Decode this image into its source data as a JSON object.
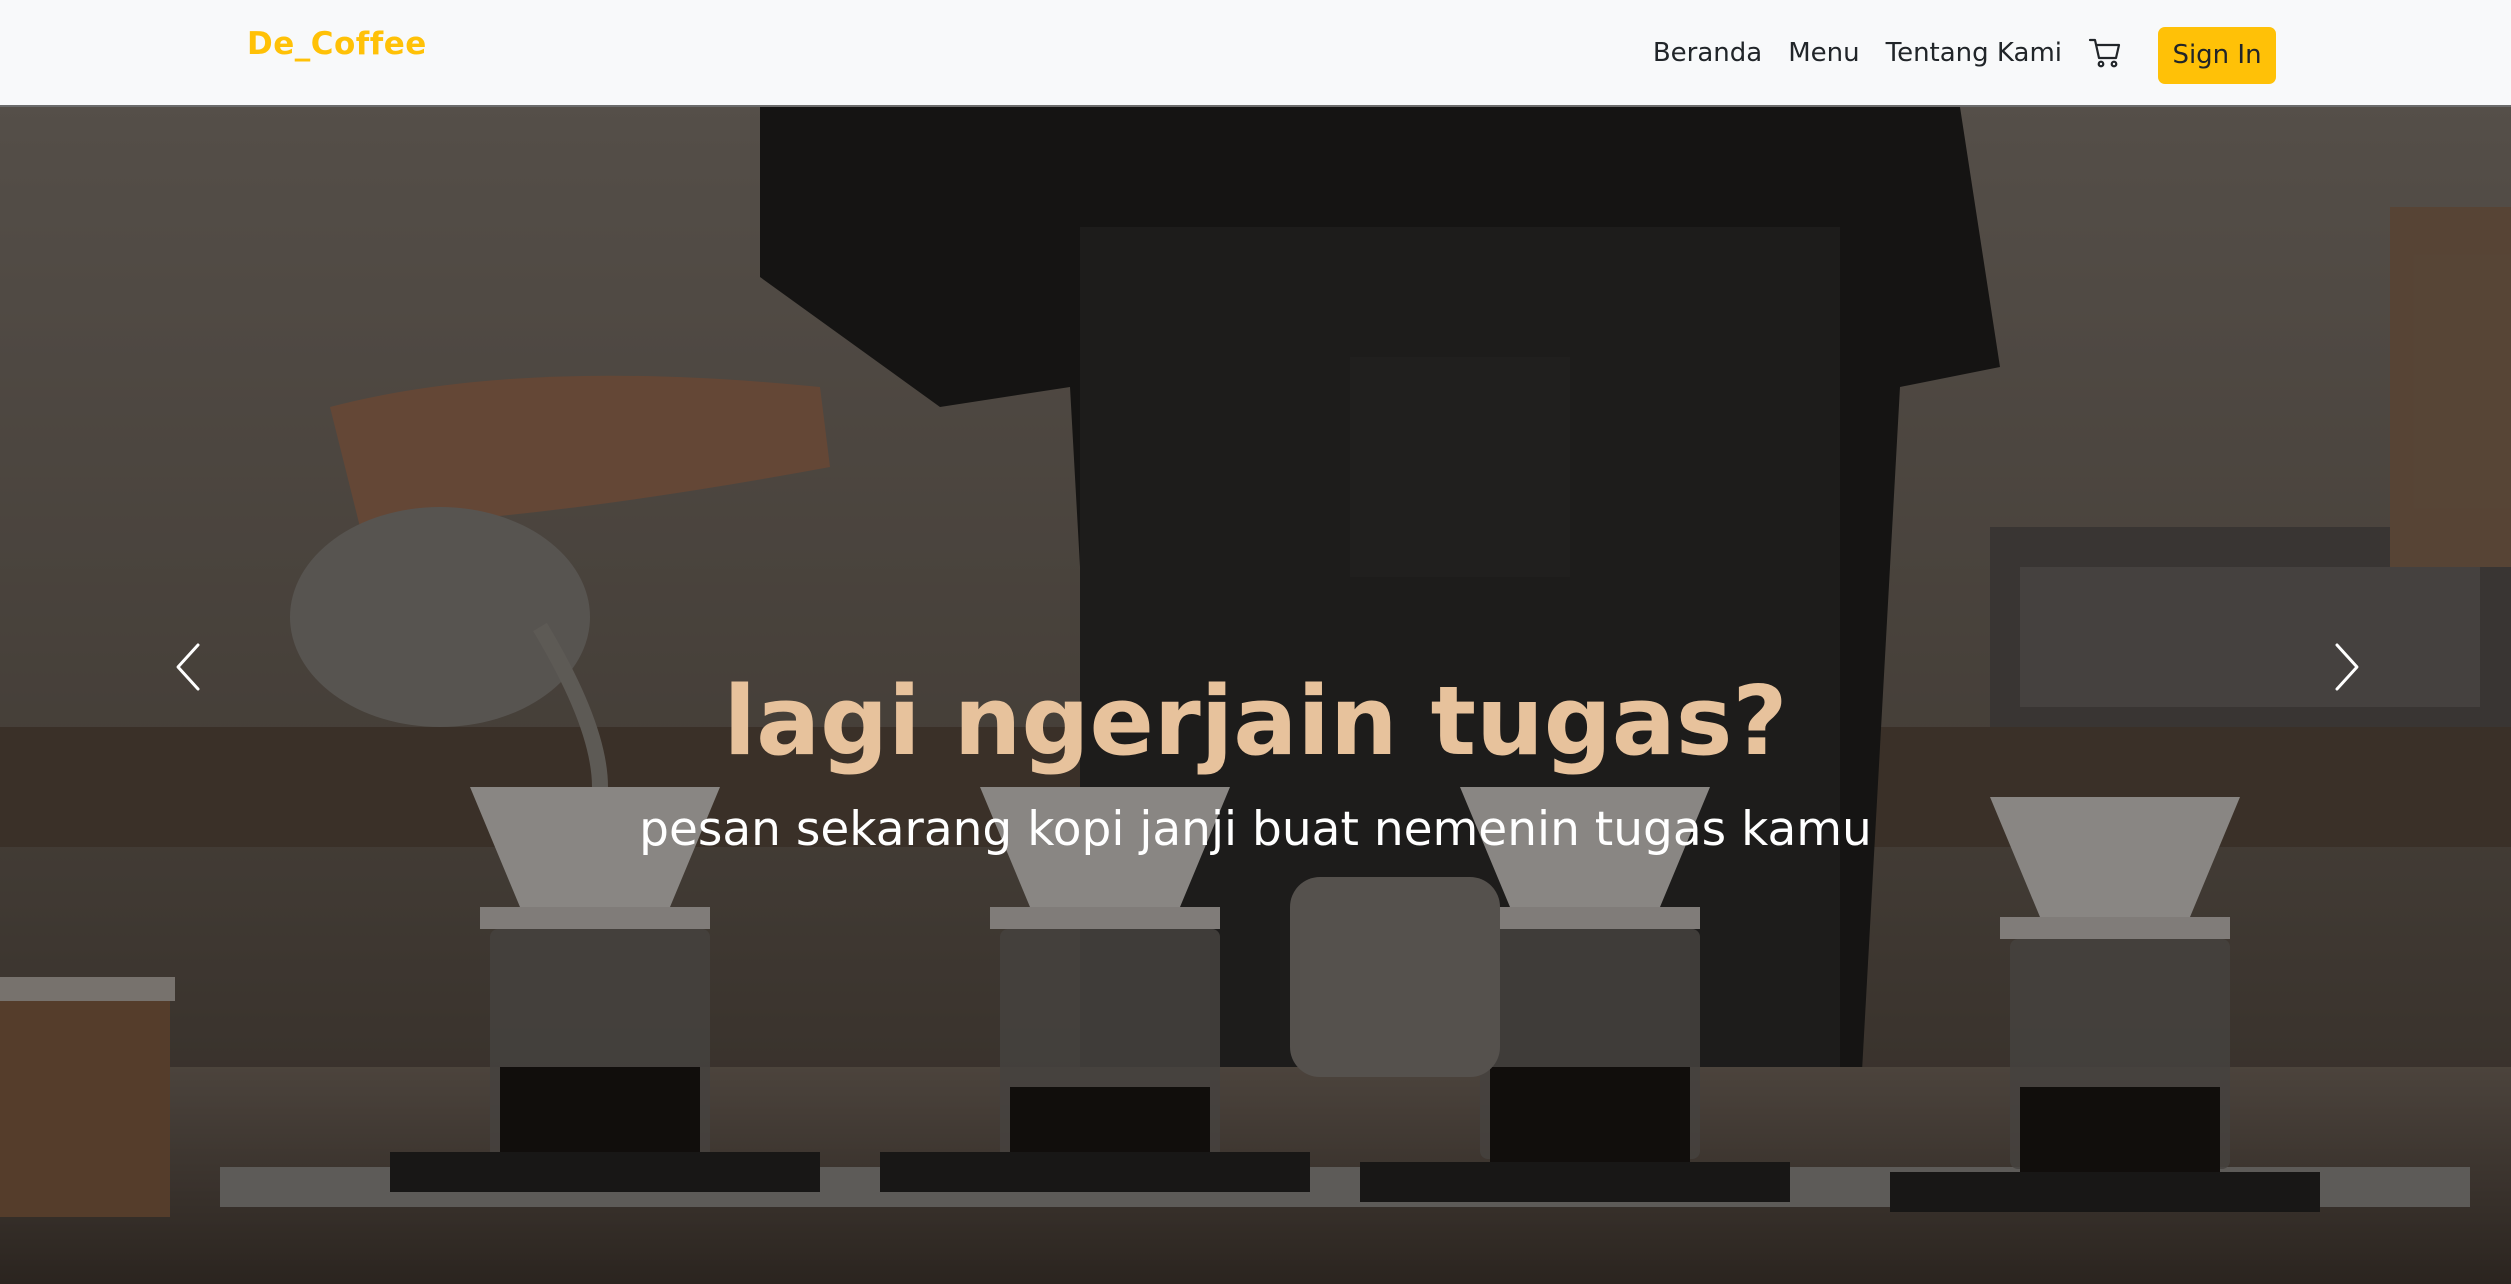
{
  "navbar": {
    "brand": "De_Coffee",
    "links": [
      {
        "label": "Beranda"
      },
      {
        "label": "Menu"
      },
      {
        "label": "Tentang Kami"
      }
    ],
    "cart_icon": "cart-icon",
    "signin_label": "Sign In",
    "accent_color": "#ffc107"
  },
  "hero": {
    "title": "lagi ngerjain tugas?",
    "subtitle": "pesan sekarang kopi janji buat nemenin tugas kamu",
    "title_color": "#e7c29c",
    "prev_icon": "chevron-left-icon",
    "next_icon": "chevron-right-icon"
  }
}
